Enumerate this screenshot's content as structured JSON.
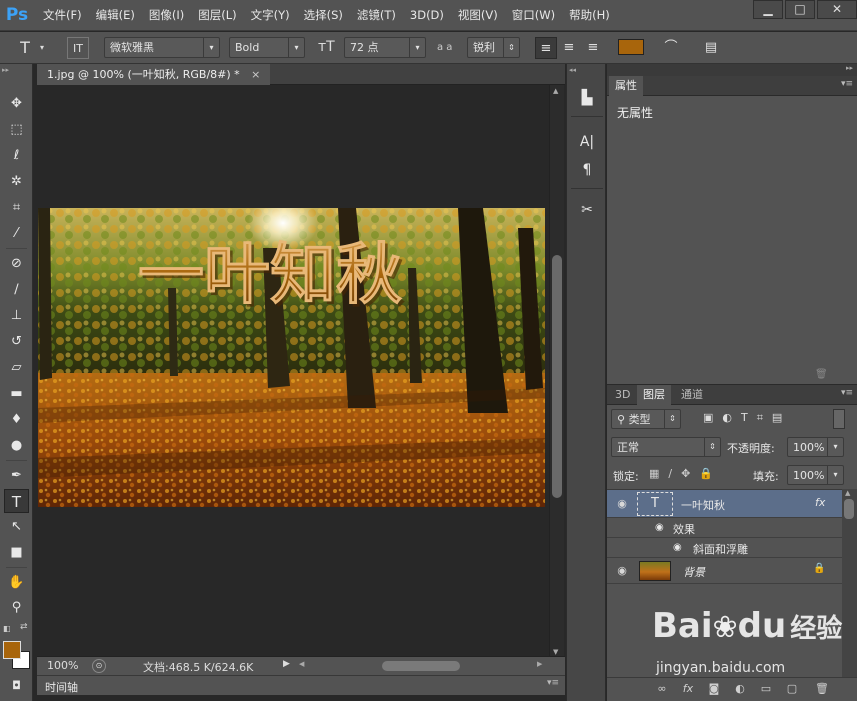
{
  "app": {
    "logo": "Ps"
  },
  "menus": [
    "文件(F)",
    "编辑(E)",
    "图像(I)",
    "图层(L)",
    "文字(Y)",
    "选择(S)",
    "滤镜(T)",
    "3D(D)",
    "视图(V)",
    "窗口(W)",
    "帮助(H)"
  ],
  "window_buttons": {
    "minimize": "▁",
    "maximize": "□",
    "close": "✕"
  },
  "options": {
    "font_family": "微软雅黑",
    "font_style": "Bold",
    "font_size": "72 点",
    "aa_label": "a a",
    "antialias": "锐利",
    "text_color": "#a8650c"
  },
  "document": {
    "tab_title": "1.jpg @ 100% (一叶知秋, RGB/8#) *",
    "tab_close": "×",
    "canvas_text": "一叶知秋",
    "zoom": "100%",
    "doc_info": "文档:468.5 K/624.6K",
    "timeline_label": "时间轴"
  },
  "properties": {
    "tab": "属性",
    "empty_text": "无属性"
  },
  "layers_panel": {
    "tabs": [
      "3D",
      "图层",
      "通道"
    ],
    "filter_kind": "类型",
    "blend_mode": "正常",
    "opacity_label": "不透明度:",
    "opacity_value": "100%",
    "lock_label": "锁定:",
    "fill_label": "填充:",
    "fill_value": "100%",
    "layers": [
      {
        "name": "一叶知秋",
        "kind": "text",
        "thumb": "T",
        "fx": "fx",
        "selected": true
      },
      {
        "name": "效果",
        "kind": "effects"
      },
      {
        "name": "斜面和浮雕",
        "kind": "effect"
      },
      {
        "name": "背景",
        "kind": "image",
        "locked": true
      }
    ]
  },
  "watermark": {
    "brand": "Bai",
    "brand2": "du",
    "suffix": "经验",
    "url": "jingyan.baidu.com"
  },
  "colors": {
    "foreground": "#a8650c",
    "background": "#ffffff",
    "ps_blue": "#3ca2f7"
  }
}
